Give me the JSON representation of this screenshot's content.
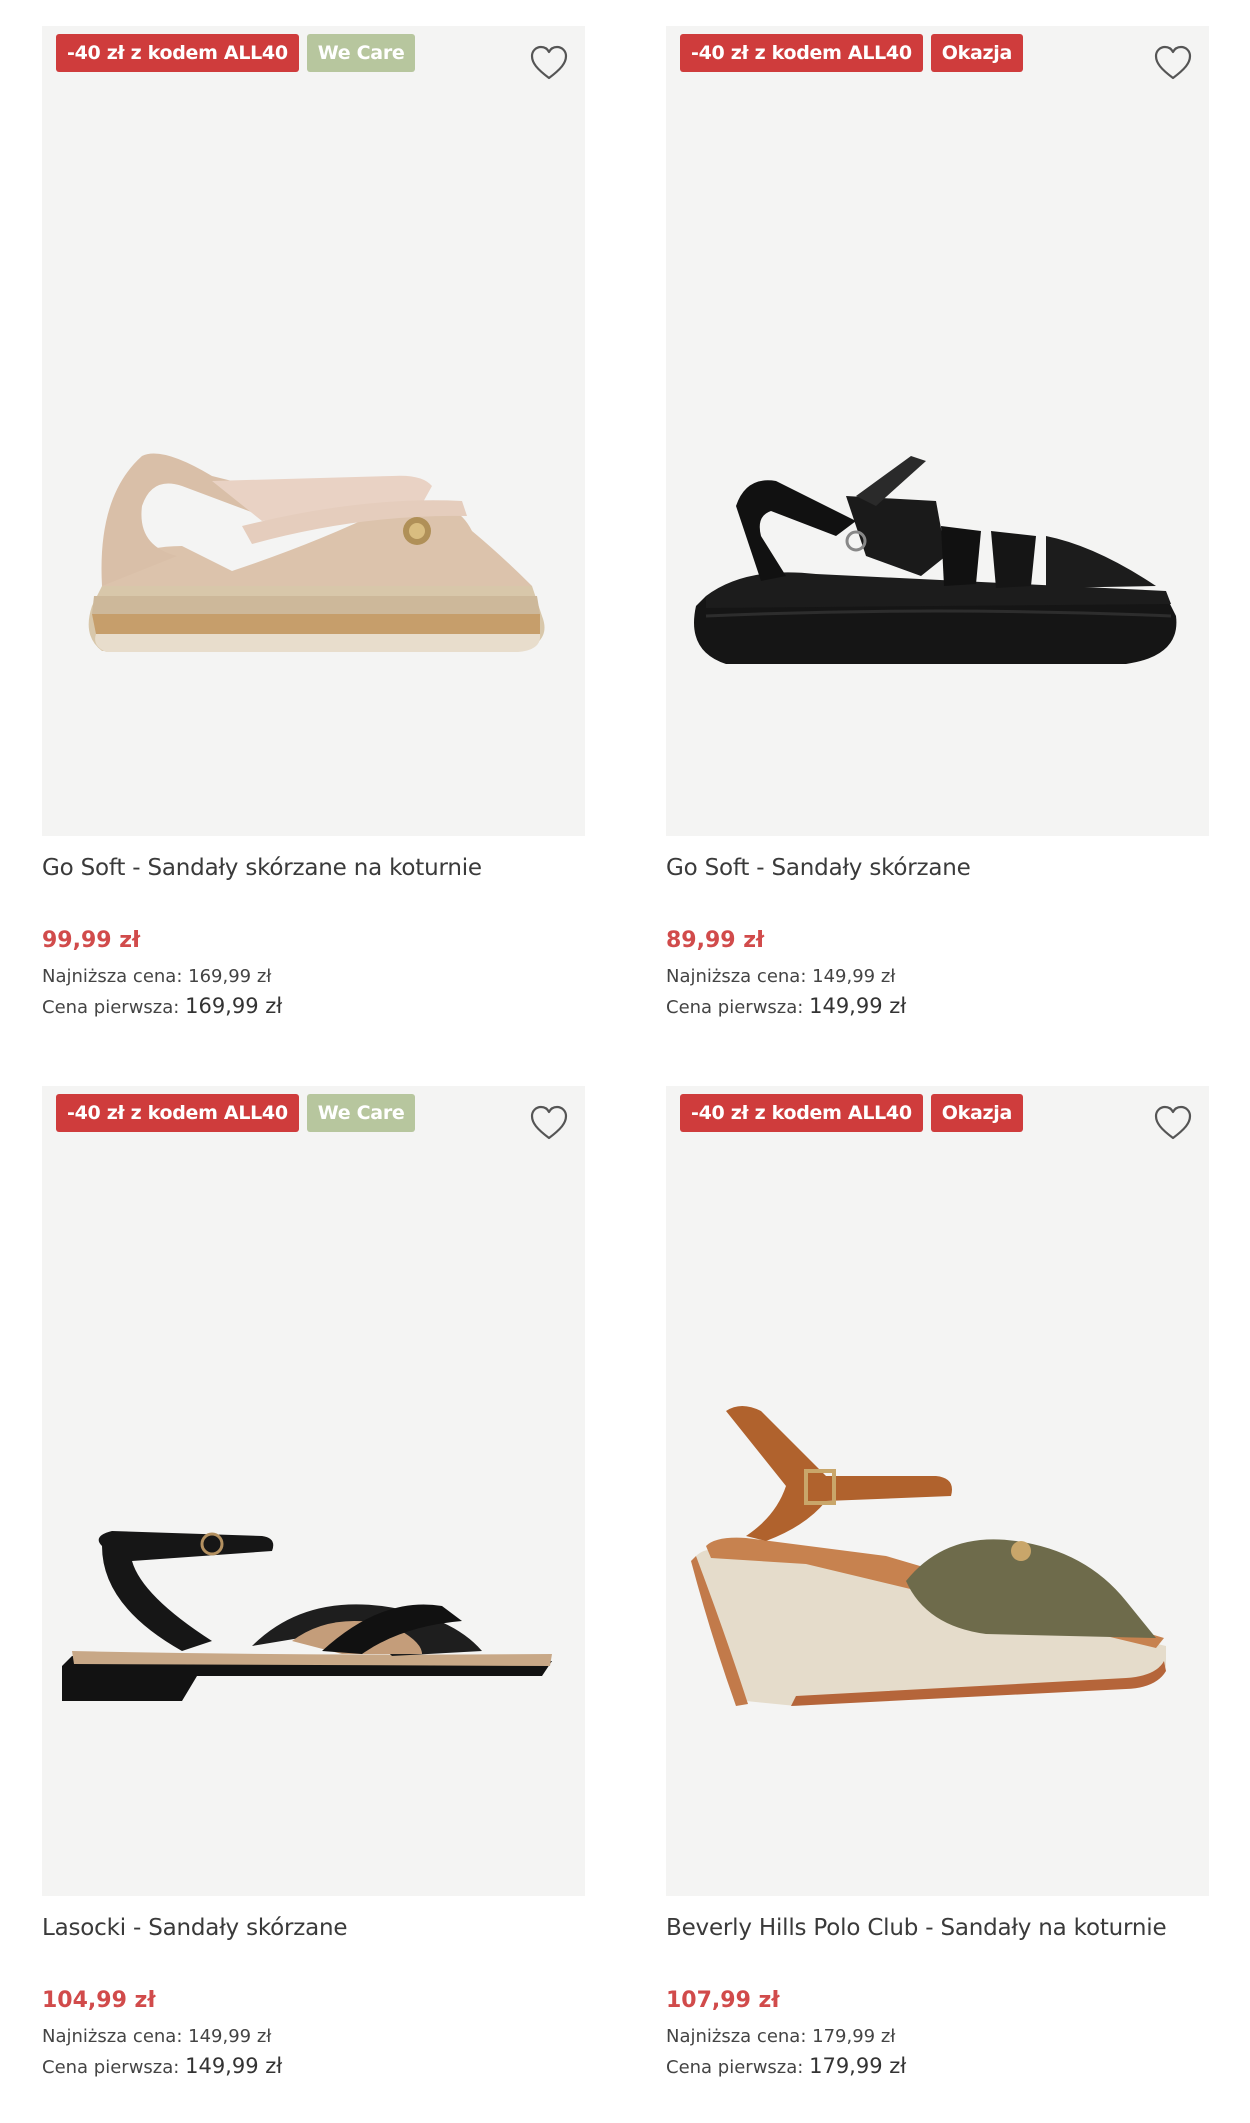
{
  "products": [
    {
      "badge_code": "-40 zł z kodem ALL40",
      "badge_tag": "We Care",
      "tag_color": "#b7c69e",
      "name": "Go Soft - Sandały skórzane na koturnie",
      "price": "99,99 zł",
      "lowest_label": "Najniższa cena:",
      "lowest_value": "169,99 zł",
      "first_label": "Cena pierwsza:",
      "first_value": "169,99 zł",
      "image_icon": "beige-wedge-sandal"
    },
    {
      "badge_code": "-40 zł z kodem ALL40",
      "badge_tag": "Okazja",
      "tag_color": "#cf3c3c",
      "name": "Go Soft - Sandały skórzane",
      "price": "89,99 zł",
      "lowest_label": "Najniższa cena:",
      "lowest_value": "149,99 zł",
      "first_label": "Cena pierwsza:",
      "first_value": "149,99 zł",
      "image_icon": "black-strap-sandal"
    },
    {
      "badge_code": "-40 zł z kodem ALL40",
      "badge_tag": "We Care",
      "tag_color": "#b7c69e",
      "name": "Lasocki - Sandały skórzane",
      "price": "104,99 zł",
      "lowest_label": "Najniższa cena:",
      "lowest_value": "149,99 zł",
      "first_label": "Cena pierwsza:",
      "first_value": "149,99 zł",
      "image_icon": "black-flat-sandal"
    },
    {
      "badge_code": "-40 zł z kodem ALL40",
      "badge_tag": "Okazja",
      "tag_color": "#cf3c3c",
      "name": "Beverly Hills Polo Club - Sandały na koturnie",
      "price": "107,99 zł",
      "lowest_label": "Najniższa cena:",
      "lowest_value": "179,99 zł",
      "first_label": "Cena pierwsza:",
      "first_value": "179,99 zł",
      "image_icon": "olive-wedge-sandal"
    }
  ],
  "colors": {
    "price_red": "#d14b4b",
    "badge_red": "#cf3c3c",
    "badge_green": "#b7c69e",
    "image_bg": "#f4f4f3"
  }
}
